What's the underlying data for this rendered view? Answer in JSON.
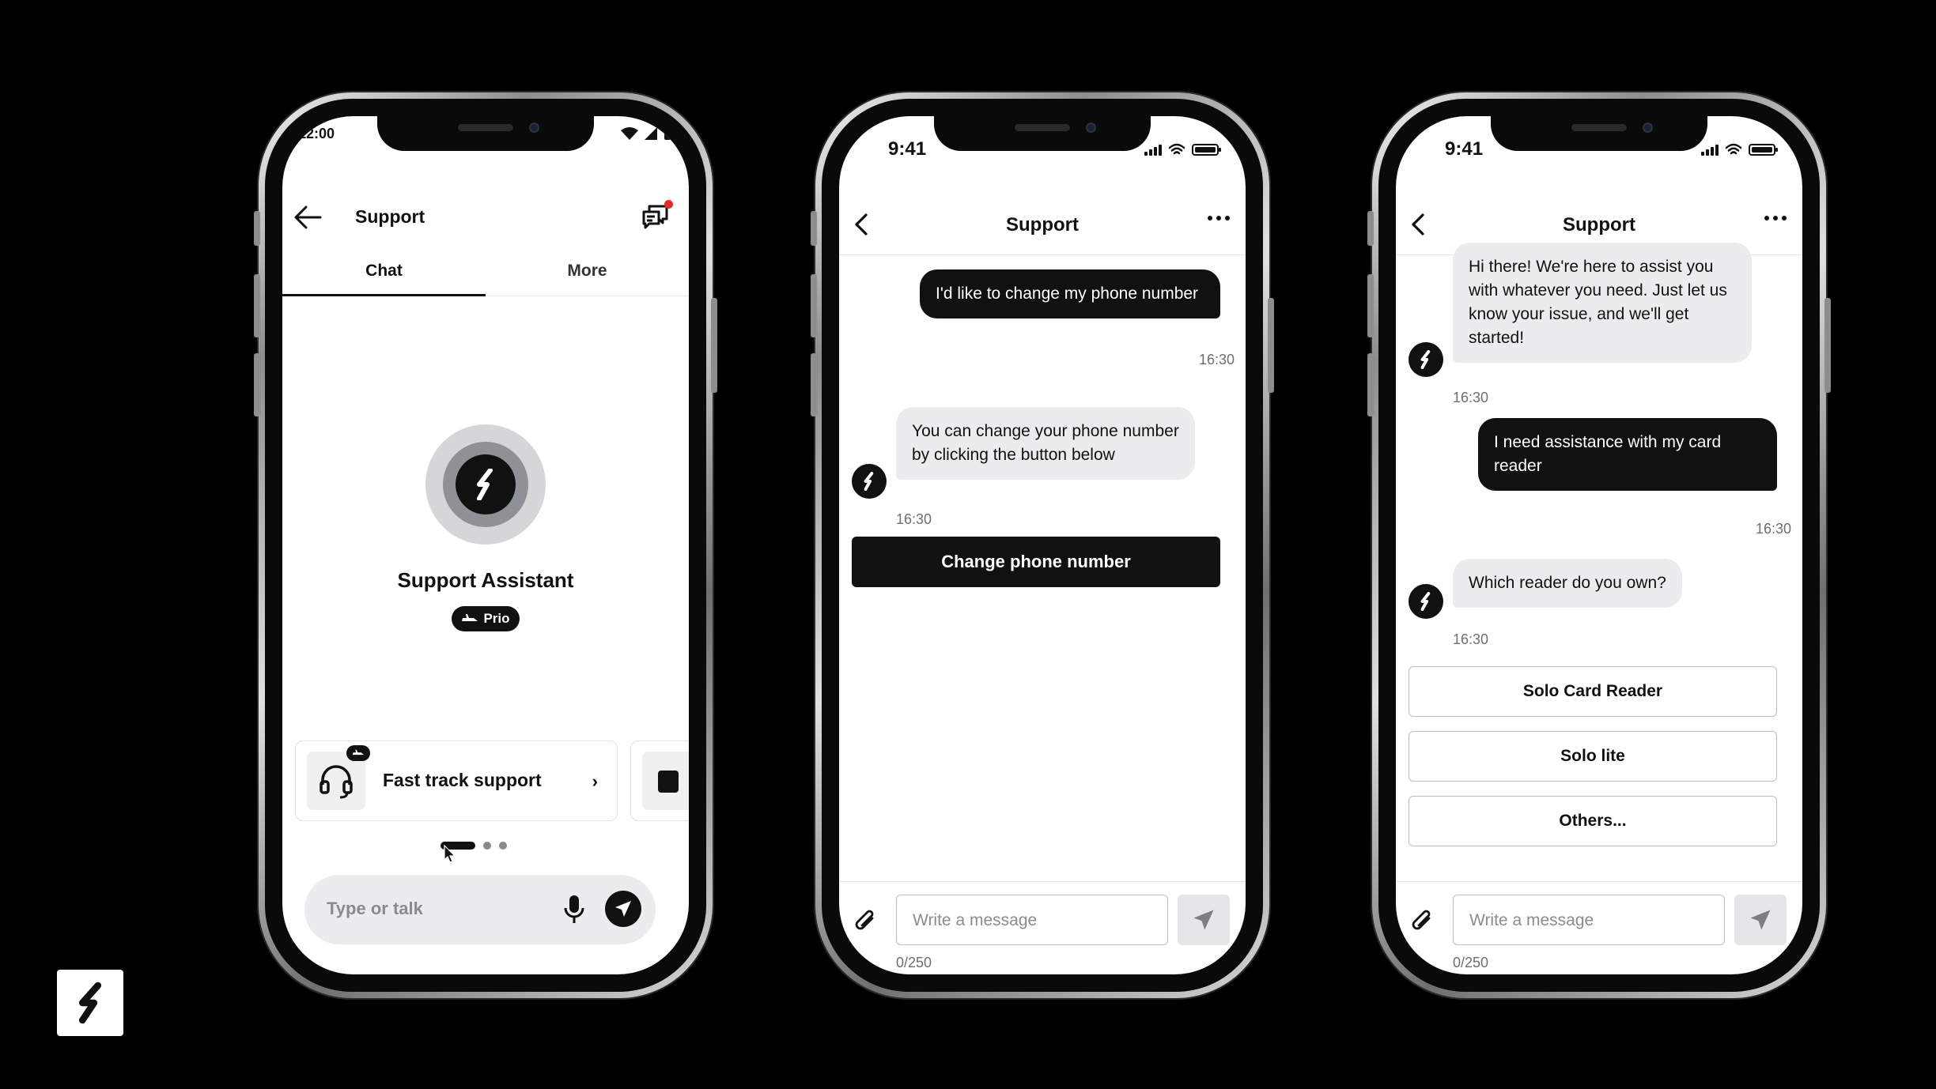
{
  "phone1": {
    "status_time": "12:00",
    "header_title": "Support",
    "tabs": [
      "Chat",
      "More"
    ],
    "assistant_name": "Support Assistant",
    "badge_label": "Prio",
    "card_label": "Fast track support",
    "input_placeholder": "Type or talk",
    "carousel_pages": 3,
    "carousel_active": 1
  },
  "phone2": {
    "status_time": "9:41",
    "header_title": "Support",
    "messages": [
      {
        "from": "user",
        "text": "I'd like to change my phone number",
        "time": "16:30"
      },
      {
        "from": "bot",
        "text": "You can change your phone number by clicking the button below",
        "time": "16:30"
      }
    ],
    "cta_label": "Change phone number",
    "input_placeholder": "Write a message",
    "char_count": "0/250"
  },
  "phone3": {
    "status_time": "9:41",
    "header_title": "Support",
    "messages": [
      {
        "from": "bot",
        "text": "Hi there! We're here to assist you with whatever you need. Just let us know your issue, and we'll get started!",
        "time": "16:30"
      },
      {
        "from": "user",
        "text": "I need assistance with my card reader",
        "time": "16:30"
      },
      {
        "from": "bot",
        "text": "Which reader do you own?",
        "time": "16:30"
      }
    ],
    "options": [
      "Solo Card Reader",
      "Solo lite",
      "Others..."
    ],
    "input_placeholder": "Write a message",
    "char_count": "0/250"
  },
  "colors": {
    "background": "#000000",
    "primary": "#111111",
    "bubble_incoming": "#ececee",
    "notification_dot": "#e02b2b"
  },
  "icons": [
    "back-arrow",
    "chat-bubbles",
    "headset",
    "microphone",
    "send",
    "paperclip",
    "more-dots",
    "brand-s-logo"
  ]
}
